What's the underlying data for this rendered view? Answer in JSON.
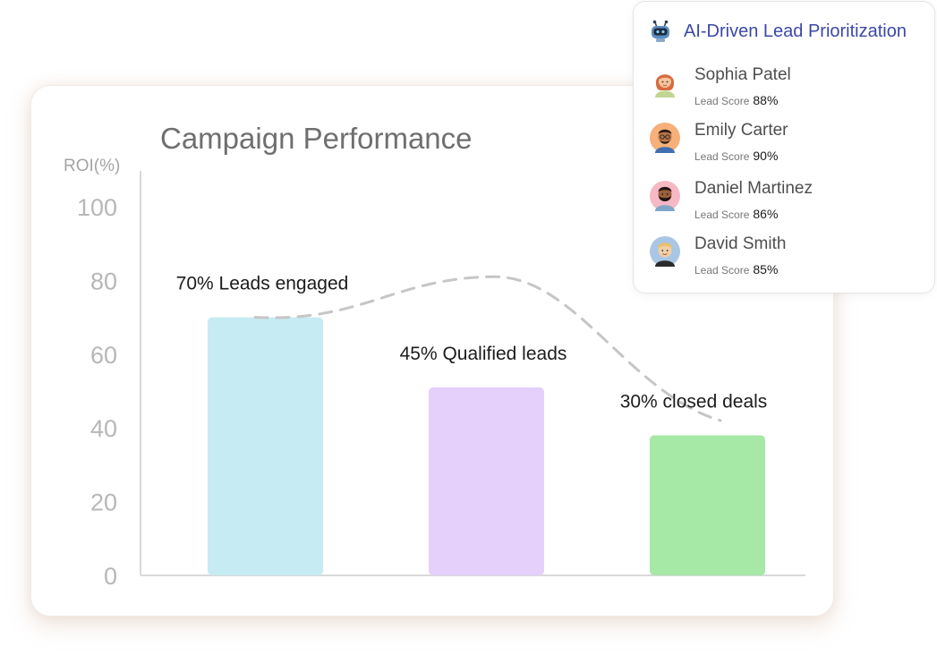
{
  "chart_data": {
    "type": "bar",
    "title": "Campaign Performance",
    "ylabel": "ROI(%)",
    "xlabel": "",
    "ylim": [
      0,
      100
    ],
    "yticks": [
      "0",
      "20",
      "40",
      "60",
      "80",
      "100"
    ],
    "categories": [
      "Leads engaged",
      "Qualified leads",
      "closed deals"
    ],
    "values": [
      70,
      51,
      38
    ],
    "bar_labels": [
      "70% Leads engaged",
      "45% Qualified leads",
      "30% closed deals"
    ],
    "bar_colors": [
      "#c6ebf2",
      "#e4d0fb",
      "#a6e8a6"
    ],
    "trend_line": {
      "style": "dashed",
      "color": "#c6c6c6",
      "values": [
        70,
        81,
        42
      ]
    },
    "grid": false
  },
  "lead_panel": {
    "title": "AI-Driven Lead Prioritization",
    "title_icon": "robot-icon",
    "title_color": "#3b48a8",
    "leads": [
      {
        "name": "Sophia Patel",
        "score_label": "Lead Score",
        "score": "88%",
        "avatar": "woman-avatar-icon"
      },
      {
        "name": "Emily Carter",
        "score_label": "Lead Score",
        "score": "90%",
        "avatar": "man-glasses-avatar-icon"
      },
      {
        "name": "Daniel Martinez",
        "score_label": "Lead Score",
        "score": "86%",
        "avatar": "bearded-man-avatar-icon"
      },
      {
        "name": "David Smith",
        "score_label": "Lead Score",
        "score": "85%",
        "avatar": "blond-man-avatar-icon"
      }
    ]
  }
}
